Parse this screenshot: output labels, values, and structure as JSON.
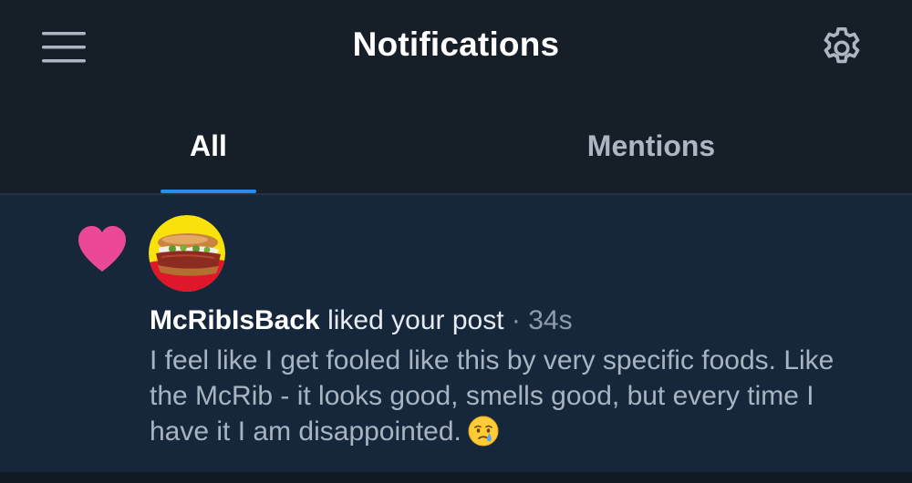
{
  "header": {
    "title": "Notifications",
    "menu_icon": "hamburger-menu-icon",
    "settings_icon": "gear-icon"
  },
  "tabs": [
    {
      "label": "All",
      "active": true
    },
    {
      "label": "Mentions",
      "active": false
    }
  ],
  "notification": {
    "type_icon": "heart-icon",
    "username": "McRibIsBack",
    "action": "liked your post",
    "separator": "·",
    "time": "34s",
    "post_text": "I feel like I get fooled like this by very specific foods. Like the McRib - it looks good, smells good, but every time I have it I am disappointed.",
    "emoji": "crying-face-icon"
  },
  "colors": {
    "header_bg": "#161e28",
    "notification_bg": "#16273c",
    "accent": "#2a8cf0",
    "heart": "#ec4899"
  }
}
